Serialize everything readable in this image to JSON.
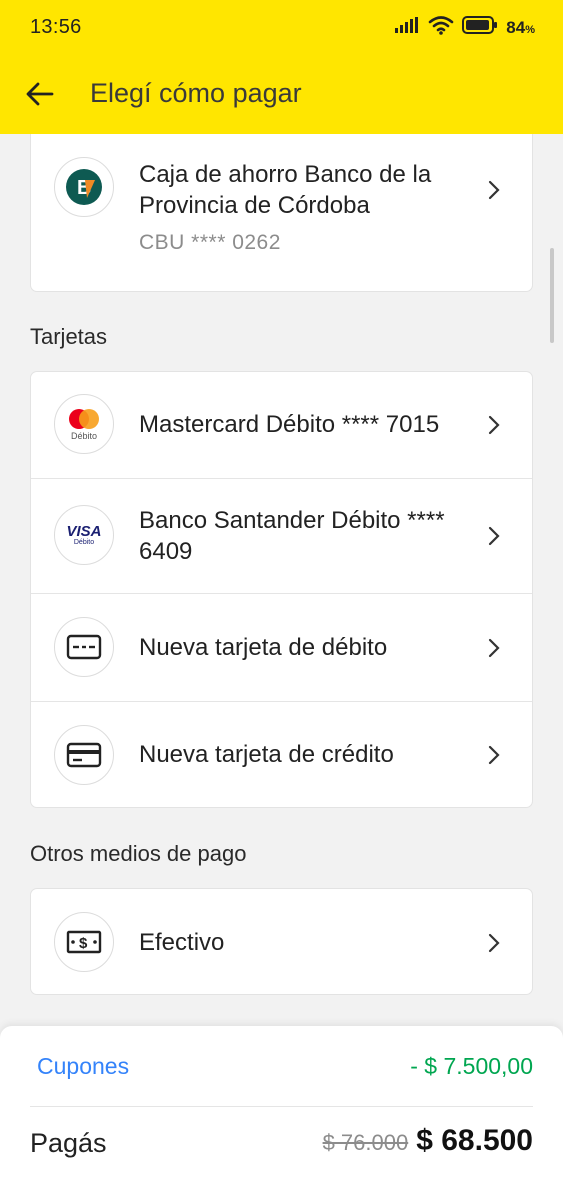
{
  "status_bar": {
    "time": "13:56",
    "battery_pct": "84",
    "battery_unit": "%"
  },
  "header": {
    "title": "Elegí cómo pagar"
  },
  "bank_account": {
    "name": "Caja de ahorro Banco de la Provincia de Córdoba",
    "cbu": "CBU **** 0262",
    "logo_letter": "B"
  },
  "cards_section": {
    "title": "Tarjetas",
    "items": [
      {
        "label": "Mastercard Débito **** 7015",
        "badge": "Débito"
      },
      {
        "label": "Banco Santander Débito **** 6409",
        "brand": "VISA",
        "brand_sub": "Débito"
      },
      {
        "label": "Nueva tarjeta de débito"
      },
      {
        "label": "Nueva tarjeta de crédito"
      }
    ]
  },
  "other_section": {
    "title": "Otros medios de pago",
    "items": [
      {
        "label": "Efectivo"
      }
    ]
  },
  "summary": {
    "coupons_label": "Cupones",
    "coupons_value": "- $ 7.500,00",
    "pay_label": "Pagás",
    "old_price": "$ 76.000",
    "new_price": "$ 68.500"
  },
  "colors": {
    "brand_yellow": "#ffe600",
    "link_blue": "#3483fa",
    "discount_green": "#00a650",
    "bancor_teal": "#0e5a52",
    "bancor_orange": "#f08a24",
    "mastercard_red": "#eb001b",
    "mastercard_orange": "#f79e1b",
    "visa_blue": "#1a1f71"
  }
}
